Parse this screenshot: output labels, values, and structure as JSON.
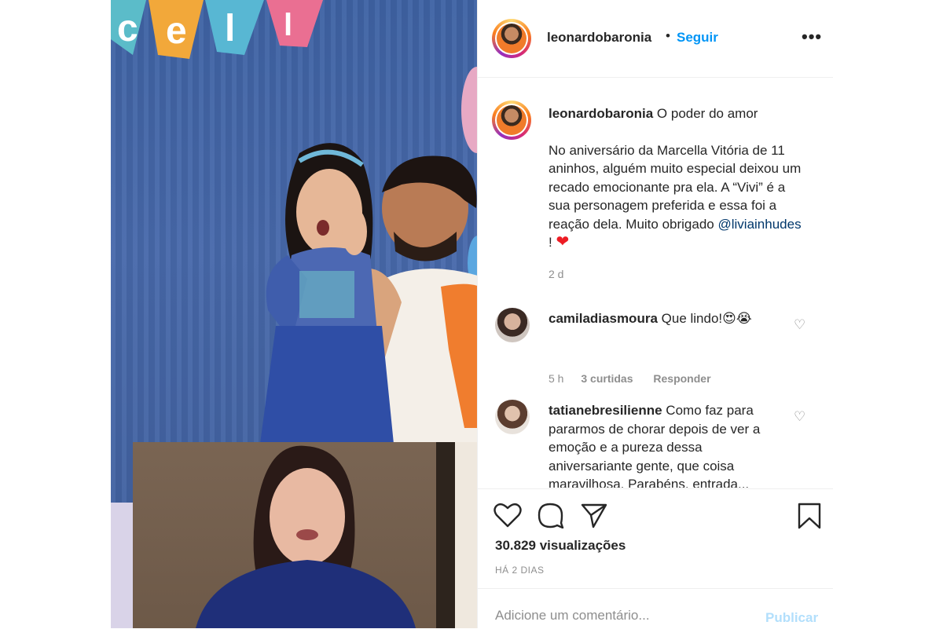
{
  "post": {
    "username": "leonardobaronia",
    "follow_label": "Seguir",
    "dot": "•",
    "more_icon": "more-icon",
    "caption_title": "O poder do amor",
    "caption_body": "No aniversário da Marcella Vitória de 11 aninhos, alguém muito especial deixou um recado emocionante pra ela. A “Vivi” é a sua personagem preferida e essa foi a reação dela. Muito obrigado",
    "caption_mention": "@liviainhudes",
    "caption_end": " !",
    "caption_emoji": "❤",
    "posted_time": "2 d",
    "views": "30.829 visualizações",
    "posted_ago": "HÁ 2 DIAS",
    "media_banner_text": "cel"
  },
  "comments": [
    {
      "username": "camiladiasmoura",
      "text": "Que lindo!😍😭",
      "time": "5 h",
      "likes": "3 curtidas",
      "reply": "Responder"
    },
    {
      "username": "tatianebresilienne",
      "text": "Como faz para pararmos de chorar depois de ver a emoção e a pureza dessa aniversariante gente, que coisa maravilhosa. Parabéns, entrada...",
      "time": "",
      "likes": "",
      "reply": ""
    }
  ],
  "add_comment": {
    "placeholder": "Adicione um comentário...",
    "publish_label": "Publicar"
  },
  "colors": {
    "accent": "#0095f6",
    "publish_disabled": "#b2dffc",
    "text": "#262626",
    "muted": "#8e8e8e",
    "heart": "#ed1c24"
  }
}
